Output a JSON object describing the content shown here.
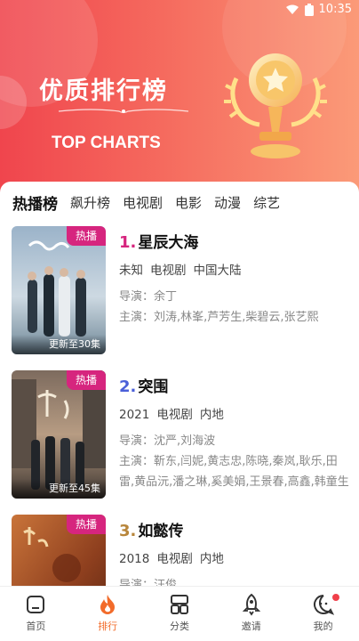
{
  "status": {
    "time": "10:35"
  },
  "hero": {
    "title": "优质排行榜",
    "subtitle": "TOP CHARTS"
  },
  "tabs": [
    "热播榜",
    "飙升榜",
    "电视剧",
    "电影",
    "动漫",
    "综艺"
  ],
  "labels": {
    "director_prefix": "导演：",
    "cast_prefix": "主演："
  },
  "items": [
    {
      "rank": "1.",
      "rank_color": "#d6257e",
      "title": "星辰大海",
      "year": "未知",
      "type": "电视剧",
      "region": "中国大陆",
      "badge": "热播",
      "update": "更新至30集",
      "director": "余丁",
      "cast": "刘涛,林峯,芦芳生,柴碧云,张艺熙"
    },
    {
      "rank": "2.",
      "rank_color": "#4a5fd8",
      "title": "突围",
      "year": "2021",
      "type": "电视剧",
      "region": "内地",
      "badge": "热播",
      "update": "更新至45集",
      "director": "沈严,刘海波",
      "cast": "靳东,闫妮,黄志忠,陈晓,秦岚,耿乐,田雷,黄品沅,潘之琳,奚美娟,王景春,高鑫,韩童生"
    },
    {
      "rank": "3.",
      "rank_color": "#b8863b",
      "title": "如懿传",
      "year": "2018",
      "type": "电视剧",
      "region": "内地",
      "badge": "热播",
      "update": "",
      "director": "汪俊",
      "cast": ""
    }
  ],
  "tabbar": [
    {
      "label": "首页",
      "icon": "home-icon"
    },
    {
      "label": "排行",
      "icon": "flame-icon",
      "active": true
    },
    {
      "label": "分类",
      "icon": "category-icon"
    },
    {
      "label": "邀请",
      "icon": "rocket-icon"
    },
    {
      "label": "我的",
      "icon": "profile-icon",
      "dot": true
    }
  ],
  "colors": {
    "accent": "#f26b2a",
    "badge": "#d6257e",
    "hero_start": "#f0454d",
    "hero_end": "#fb9a78"
  }
}
